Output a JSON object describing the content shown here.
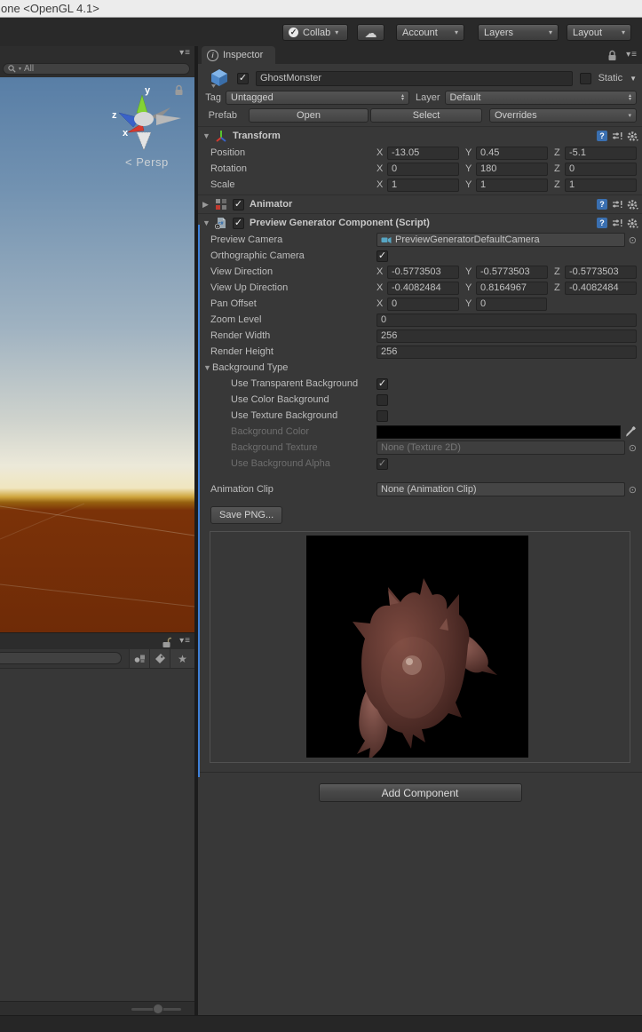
{
  "window": {
    "title": "one <OpenGL 4.1>"
  },
  "toolbar": {
    "collab_label": "Collab",
    "account_label": "Account",
    "layers_label": "Layers",
    "layout_label": "Layout"
  },
  "icons": {
    "picker": "⊙",
    "menu": "≡",
    "caret": "▾",
    "cloud": "☁",
    "check": "✓",
    "fold_open": "▼",
    "fold_closed": "▶",
    "up": "▴",
    "down": "▾",
    "star": "★",
    "static_caret": "▼",
    "info": "i",
    "help": "?",
    "less_than": "<"
  },
  "scene_panel": {
    "search_value": "All",
    "persp_label": "Persp",
    "gizmo": {
      "x": "x",
      "y": "y",
      "z": "z"
    }
  },
  "axis_labels": {
    "x": "X",
    "y": "Y",
    "z": "Z"
  },
  "inspector": {
    "tab_label": "Inspector",
    "gameobject": {
      "name": "GhostMonster",
      "static_label": "Static",
      "tag_label": "Tag",
      "tag_value": "Untagged",
      "layer_label": "Layer",
      "layer_value": "Default",
      "prefab_label": "Prefab",
      "open_label": "Open",
      "select_label": "Select",
      "overrides_label": "Overrides"
    },
    "transform": {
      "title": "Transform",
      "position": {
        "label": "Position",
        "x": "-13.05",
        "y": "0.45",
        "z": "-5.1"
      },
      "rotation": {
        "label": "Rotation",
        "x": "0",
        "y": "180",
        "z": "0"
      },
      "scale": {
        "label": "Scale",
        "x": "1",
        "y": "1",
        "z": "1"
      }
    },
    "animator": {
      "title": "Animator"
    },
    "preview_generator": {
      "title": "Preview Generator Component (Script)",
      "preview_camera_label": "Preview Camera",
      "preview_camera_value": "PreviewGeneratorDefaultCamera",
      "orthographic_label": "Orthographic Camera",
      "view_direction": {
        "label": "View Direction",
        "x": "-0.5773503",
        "y": "-0.5773503",
        "z": "-0.5773503"
      },
      "view_up_direction": {
        "label": "View Up Direction",
        "x": "-0.4082484",
        "y": "0.8164967",
        "z": "-0.4082484"
      },
      "pan_offset": {
        "label": "Pan Offset",
        "x": "0",
        "y": "0"
      },
      "zoom_level_label": "Zoom Level",
      "zoom_level_value": "0",
      "render_width_label": "Render Width",
      "render_width_value": "256",
      "render_height_label": "Render Height",
      "render_height_value": "256",
      "background_type": {
        "title": "Background Type",
        "use_transparent_label": "Use Transparent Background",
        "use_color_label": "Use Color Background",
        "use_texture_label": "Use Texture Background",
        "background_color_label": "Background Color",
        "background_texture_label": "Background Texture",
        "background_texture_value": "None (Texture 2D)",
        "use_alpha_label": "Use Background Alpha"
      },
      "animation_clip_label": "Animation Clip",
      "animation_clip_value": "None (Animation Clip)",
      "save_png_label": "Save PNG..."
    },
    "add_component_label": "Add Component"
  },
  "state": {
    "gameobject_active": true,
    "static_checked": false,
    "animator_enabled": true,
    "pgc_enabled": true,
    "orthographic": true,
    "use_transparent": true,
    "use_color": false,
    "use_texture": false,
    "use_alpha": true
  },
  "colors": {
    "override_bar": "#3e80d8",
    "sky_top": "#587ea6",
    "ground": "#7b3208",
    "background_color_value": "#000000"
  }
}
